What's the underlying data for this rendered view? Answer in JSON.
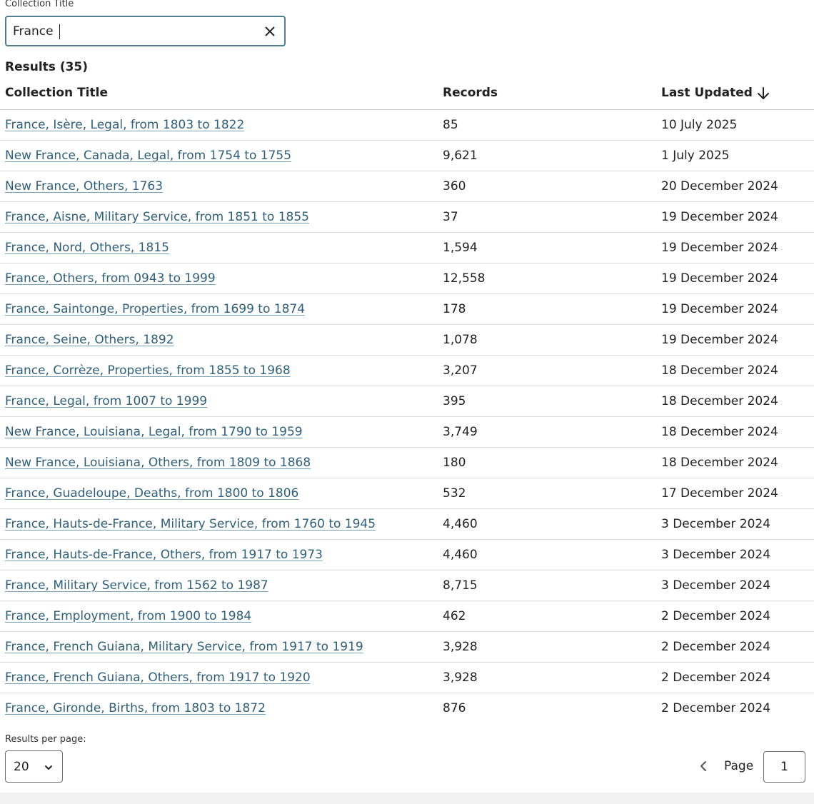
{
  "search": {
    "label": "Collection Title",
    "value": "France",
    "clear_icon": "close-icon"
  },
  "results": {
    "label": "Results (35)"
  },
  "table": {
    "headers": {
      "title": "Collection Title",
      "records": "Records",
      "updated": "Last Updated",
      "sort_icon": "arrow-down-icon"
    },
    "rows": [
      {
        "title": "France, Isère, Legal, from 1803 to 1822",
        "records": "85",
        "updated": "10 July 2025"
      },
      {
        "title": "New France, Canada, Legal, from 1754 to 1755",
        "records": "9,621",
        "updated": "1 July 2025"
      },
      {
        "title": "New France, Others, 1763",
        "records": "360",
        "updated": "20 December 2024"
      },
      {
        "title": "France, Aisne, Military Service, from 1851 to 1855",
        "records": "37",
        "updated": "19 December 2024"
      },
      {
        "title": "France, Nord, Others, 1815",
        "records": "1,594",
        "updated": "19 December 2024"
      },
      {
        "title": "France, Others, from 0943 to 1999",
        "records": "12,558",
        "updated": "19 December 2024"
      },
      {
        "title": "France, Saintonge, Properties, from 1699 to 1874",
        "records": "178",
        "updated": "19 December 2024"
      },
      {
        "title": "France, Seine, Others, 1892",
        "records": "1,078",
        "updated": "19 December 2024"
      },
      {
        "title": "France, Corrèze, Properties, from 1855 to 1968",
        "records": "3,207",
        "updated": "18 December 2024"
      },
      {
        "title": "France, Legal, from 1007 to 1999",
        "records": "395",
        "updated": "18 December 2024"
      },
      {
        "title": "New France, Louisiana, Legal, from 1790 to 1959",
        "records": "3,749",
        "updated": "18 December 2024"
      },
      {
        "title": "New France, Louisiana, Others, from 1809 to 1868",
        "records": "180",
        "updated": "18 December 2024"
      },
      {
        "title": "France, Guadeloupe, Deaths, from 1800 to 1806",
        "records": "532",
        "updated": "17 December 2024"
      },
      {
        "title": "France, Hauts-de-France, Military Service, from 1760 to 1945",
        "records": "4,460",
        "updated": "3 December 2024"
      },
      {
        "title": "France, Hauts-de-France, Others, from 1917 to 1973",
        "records": "4,460",
        "updated": "3 December 2024"
      },
      {
        "title": "France, Military Service, from 1562 to 1987",
        "records": "8,715",
        "updated": "3 December 2024"
      },
      {
        "title": "France, Employment, from 1900 to 1984",
        "records": "462",
        "updated": "2 December 2024"
      },
      {
        "title": "France, French Guiana, Military Service, from 1917 to 1919",
        "records": "3,928",
        "updated": "2 December 2024"
      },
      {
        "title": "France, French Guiana, Others, from 1917 to 1920",
        "records": "3,928",
        "updated": "2 December 2024"
      },
      {
        "title": "France, Gironde, Births, from 1803 to 1872",
        "records": "876",
        "updated": "2 December 2024"
      }
    ]
  },
  "pagination": {
    "rpp_label": "Results per page:",
    "rpp_value": "20",
    "page_label": "Page",
    "page_value": "1",
    "prev_icon": "chevron-left-icon"
  },
  "colors": {
    "accent": "#4f7f8c",
    "link": "#2f5f79"
  }
}
